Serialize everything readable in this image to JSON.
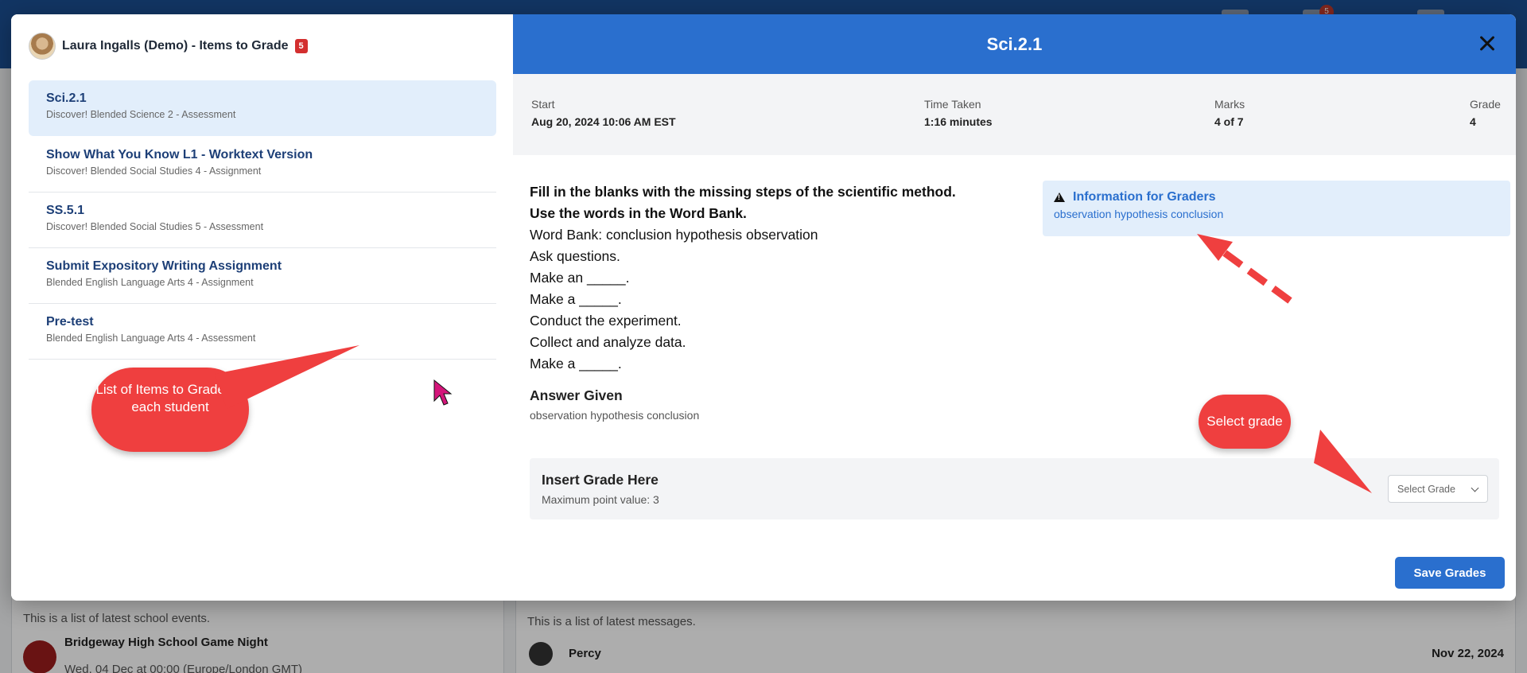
{
  "background": {
    "notification_count": "5",
    "events_desc": "This is a list of latest school events.",
    "event_title": "Bridgeway High School Game Night",
    "event_time": "Wed, 04 Dec at 00:00 (Europe/London GMT)",
    "messages_desc": "This is a list of latest messages.",
    "message_sender": "Percy",
    "message_date": "Nov 22, 2024"
  },
  "student": {
    "name": "Laura Ingalls (Demo) - Items to Grade",
    "count": "5"
  },
  "items": [
    {
      "title": "Sci.2.1",
      "subtitle": "Discover! Blended Science 2 - Assessment"
    },
    {
      "title": "Show What You Know L1 - Worktext Version",
      "subtitle": "Discover! Blended Social Studies 4 - Assignment"
    },
    {
      "title": "SS.5.1",
      "subtitle": "Discover! Blended Social Studies 5 - Assessment"
    },
    {
      "title": "Submit Expository Writing Assignment",
      "subtitle": "Blended English Language Arts 4 - Assignment"
    },
    {
      "title": "Pre-test",
      "subtitle": "Blended English Language Arts 4 - Assessment"
    }
  ],
  "detail": {
    "title": "Sci.2.1",
    "stats": {
      "start_label": "Start",
      "start_value": "Aug 20, 2024 10:06 AM EST",
      "time_label": "Time Taken",
      "time_value": "1:16 minutes",
      "marks_label": "Marks",
      "marks_value": "4 of 7",
      "grade_label": "Grade",
      "grade_value": "4"
    },
    "question_lines_bold": [
      "Fill in the blanks with the missing steps of the scientific method.",
      "Use the words in the Word Bank."
    ],
    "question_lines": [
      "Word Bank: conclusion hypothesis observation",
      "Ask questions.",
      "Make an _____.",
      "Make a _____.",
      "Conduct the experiment.",
      "Collect and analyze data.",
      "Make a _____."
    ],
    "answer_label": "Answer Given",
    "answer_value": "observation hypothesis conclusion",
    "info_title": "Information for Graders",
    "info_text": "observation hypothesis conclusion",
    "grade_heading": "Insert Grade Here",
    "grade_max": "Maximum point value: 3",
    "grade_select_placeholder": "Select Grade",
    "save_label": "Save Grades"
  },
  "annotations": {
    "list_callout": "List of Items to Grade for each student",
    "grade_callout": "Select grade"
  },
  "colors": {
    "primary": "#2a6fce",
    "callout": "#ef3f3f",
    "badge": "#d32f2f"
  }
}
